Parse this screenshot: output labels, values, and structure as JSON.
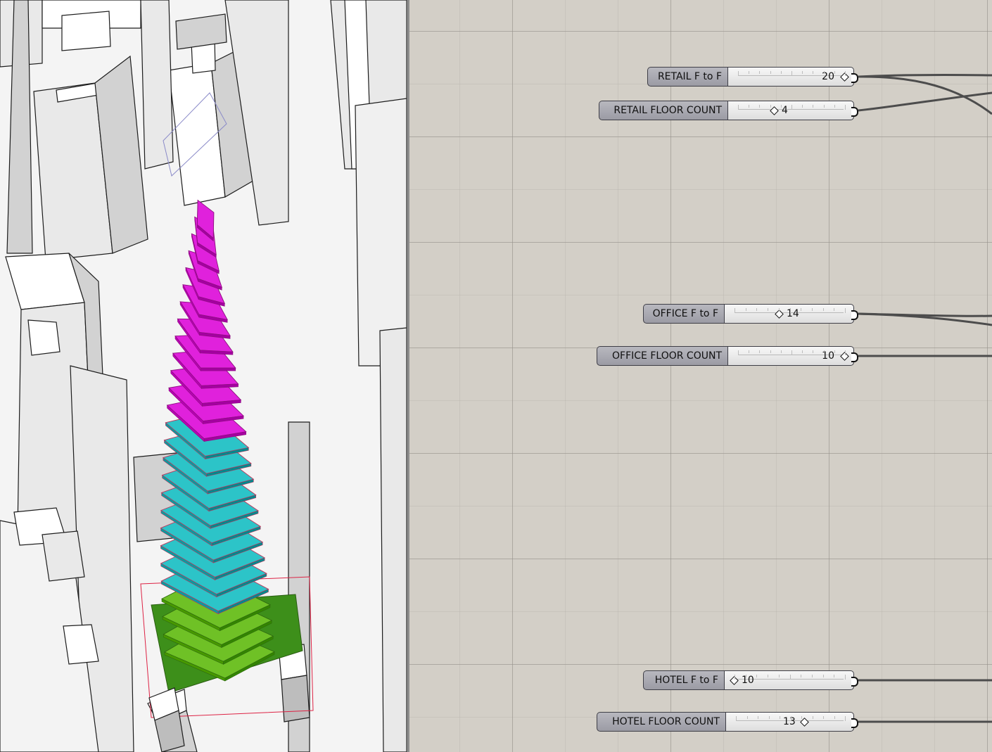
{
  "colors": {
    "retail": "#6fc126",
    "office": "#2cc4c8",
    "hotel": "#e021dc",
    "canvas": "#d3cfc7",
    "viewport": "#f4f4f4"
  },
  "sliders": [
    {
      "id": "retail-f-to-f",
      "label": "RETAIL F to F",
      "value": "20",
      "fraction": 1.0
    },
    {
      "id": "retail-floor-count",
      "label": "RETAIL FLOOR COUNT",
      "value": "4",
      "fraction": 0.3
    },
    {
      "id": "office-f-to-f",
      "label": "OFFICE F to F",
      "value": "14",
      "fraction": 0.45
    },
    {
      "id": "office-floor-count",
      "label": "OFFICE FLOOR COUNT",
      "value": "10",
      "fraction": 1.0
    },
    {
      "id": "hotel-f-to-f",
      "label": "HOTEL F to F",
      "value": "10",
      "fraction": 0.0
    },
    {
      "id": "hotel-floor-count",
      "label": "HOTEL FLOOR COUNT",
      "value": "13",
      "fraction": 0.7
    }
  ],
  "tower": {
    "retail_floors": 4,
    "office_floors": 10,
    "hotel_floors": 13
  }
}
